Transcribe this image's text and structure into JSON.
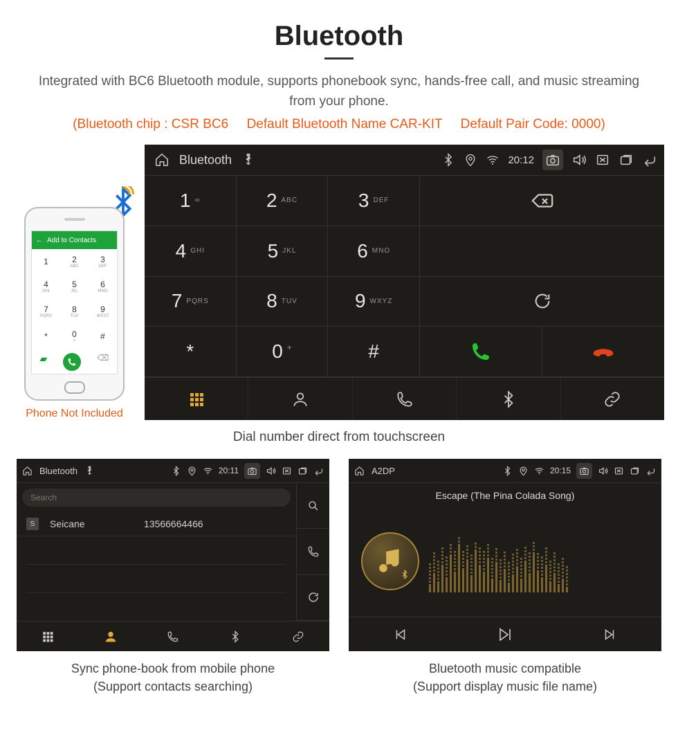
{
  "header": {
    "title": "Bluetooth",
    "description": "Integrated with BC6 Bluetooth module, supports phonebook sync, hands-free call, and music streaming from your phone.",
    "spec_chip": "(Bluetooth chip : CSR BC6",
    "spec_name": "Default Bluetooth Name CAR-KIT",
    "spec_code": "Default Pair Code: 0000)"
  },
  "phone": {
    "caption": "Phone Not Included",
    "topbar": "Add to Contacts",
    "keypad": [
      {
        "n": "1",
        "l": ""
      },
      {
        "n": "2",
        "l": "ABC"
      },
      {
        "n": "3",
        "l": "DEF"
      },
      {
        "n": "4",
        "l": "GHI"
      },
      {
        "n": "5",
        "l": "JKL"
      },
      {
        "n": "6",
        "l": "MNO"
      },
      {
        "n": "7",
        "l": "PQRS"
      },
      {
        "n": "8",
        "l": "TUV"
      },
      {
        "n": "9",
        "l": "WXYZ"
      },
      {
        "n": "*",
        "l": ""
      },
      {
        "n": "0",
        "l": "+"
      },
      {
        "n": "#",
        "l": ""
      }
    ]
  },
  "dial": {
    "title": "Bluetooth",
    "time": "20:12",
    "keys": [
      {
        "n": "1",
        "l": "∞"
      },
      {
        "n": "2",
        "l": "ABC"
      },
      {
        "n": "3",
        "l": "DEF"
      },
      {
        "n": "4",
        "l": "GHI"
      },
      {
        "n": "5",
        "l": "JKL"
      },
      {
        "n": "6",
        "l": "MNO"
      },
      {
        "n": "7",
        "l": "PQRS"
      },
      {
        "n": "8",
        "l": "TUV"
      },
      {
        "n": "9",
        "l": "WXYZ"
      },
      {
        "n": "*",
        "l": ""
      },
      {
        "n": "0",
        "l": "+"
      },
      {
        "n": "#",
        "l": ""
      }
    ],
    "caption": "Dial number direct from touchscreen"
  },
  "phonebook": {
    "title": "Bluetooth",
    "time": "20:11",
    "search_placeholder": "Search",
    "contacts": [
      {
        "badge": "S",
        "name": "Seicane",
        "number": "13566664466"
      }
    ],
    "caption1": "Sync phone-book from mobile phone",
    "caption2": "(Support contacts searching)"
  },
  "music": {
    "title": "A2DP",
    "time": "20:15",
    "track": "Escape (The Pina Colada Song)",
    "caption1": "Bluetooth music compatible",
    "caption2": "(Support display music file name)"
  }
}
